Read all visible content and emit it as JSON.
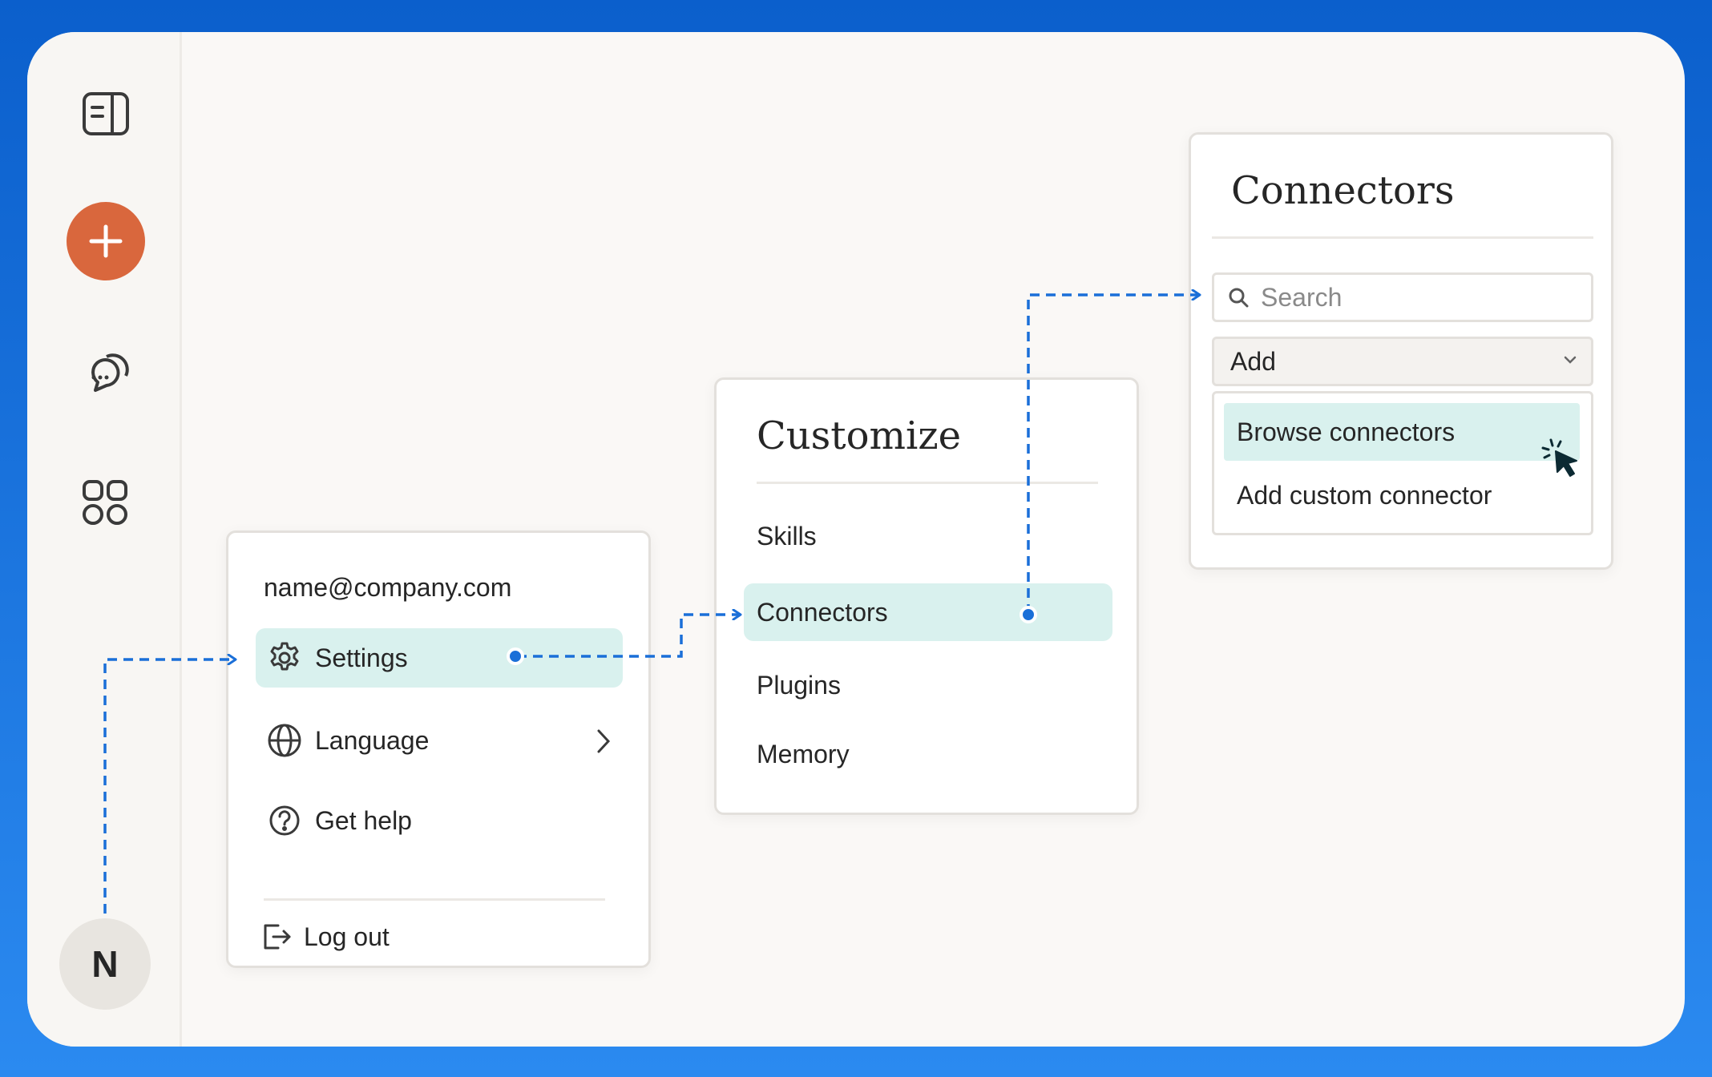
{
  "sidebar": {
    "icons": [
      "sidebar-toggle-icon",
      "plus-icon",
      "chat-bubbles-icon",
      "apps-grid-icon"
    ],
    "avatar_letter": "N",
    "new_button_color": "#d9673d"
  },
  "account_menu": {
    "email": "name@company.com",
    "items": [
      {
        "label": "Settings",
        "icon": "gear-icon",
        "highlighted": true
      },
      {
        "label": "Language",
        "icon": "globe-icon",
        "has_submenu": true
      },
      {
        "label": "Get help",
        "icon": "help-circle-icon"
      },
      {
        "label": "Log out",
        "icon": "logout-icon"
      }
    ]
  },
  "customize_menu": {
    "title": "Customize",
    "items": [
      {
        "label": "Skills"
      },
      {
        "label": "Connectors",
        "highlighted": true
      },
      {
        "label": "Plugins"
      },
      {
        "label": "Memory"
      }
    ]
  },
  "connectors_panel": {
    "title": "Connectors",
    "search_placeholder": "Search",
    "add_select_value": "Add",
    "dropdown_options": [
      {
        "label": "Browse connectors",
        "highlighted": true
      },
      {
        "label": "Add custom connector"
      }
    ]
  },
  "colors": {
    "highlight": "#d9f1ee",
    "flow_line": "#1a6fd8",
    "frame_background": "#faf8f6"
  }
}
